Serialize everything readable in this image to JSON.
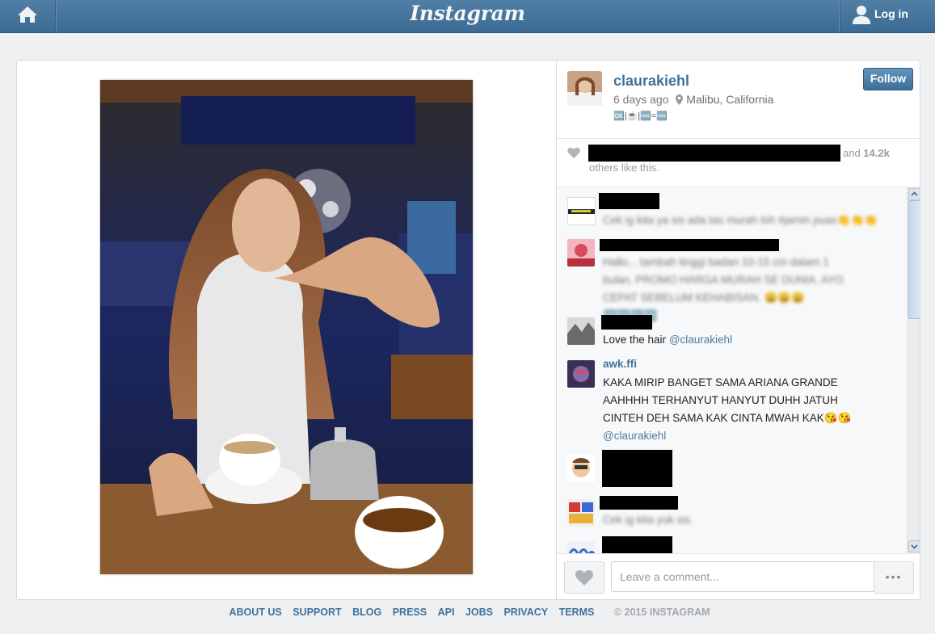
{
  "header": {
    "logo": "Instagram",
    "login_label": "Log in"
  },
  "post": {
    "username": "claurakiehl",
    "time_ago": "6 days ago",
    "location": "Malibu, California",
    "caption": "🆗|☕|🆒=🆒",
    "follow_label": "Follow",
    "likes_suffix": "and",
    "likes_count": "14.2k",
    "likes_line2": "others like this."
  },
  "comments": [
    {
      "user": "",
      "text": "Cek ig kita ya sis ada tas murah loh #jamin puas👏👏👏",
      "blurred": true
    },
    {
      "user": "",
      "text": "Hallo... tambah tinggi badan 10-15 cm dalam 1 bulan. PROMO HARGA MURAH SE DUNIA. AYO CEPAT SEBELUM KEHABISAN. 😀😀😀🆒🆒🆒🆒",
      "blurred": true
    },
    {
      "user": "",
      "text": "Love the hair",
      "mention": "@claurakiehl",
      "blurred": false
    },
    {
      "user": "awk.ffi",
      "text": "KAKA MIRIP BANGET SAMA ARIANA GRANDE AAHHHH TERHANYUT HANYUT DUHH JATUH CINTEH DEH SAMA KAK CINTA MWAH KAK😘😘",
      "mention": "@claurakiehl",
      "blurred": false
    },
    {
      "user": "",
      "text": "",
      "blurred": false
    },
    {
      "user": "",
      "text": "Cek ig kita yuk sis.",
      "blurred": true
    },
    {
      "user": "",
      "text": "",
      "blurred": false
    }
  ],
  "composer": {
    "placeholder": "Leave a comment...",
    "more_label": "•••"
  },
  "footer": {
    "links": [
      "ABOUT US",
      "SUPPORT",
      "BLOG",
      "PRESS",
      "API",
      "JOBS",
      "PRIVACY",
      "TERMS"
    ],
    "copyright": "© 2015 INSTAGRAM"
  },
  "icons": {
    "home": "home-icon",
    "user": "user-icon",
    "location": "location-pin-icon",
    "heart": "heart-icon"
  },
  "colors": {
    "header": "#517fa4",
    "link": "#3f729b",
    "follow": "#4a7ca5"
  }
}
